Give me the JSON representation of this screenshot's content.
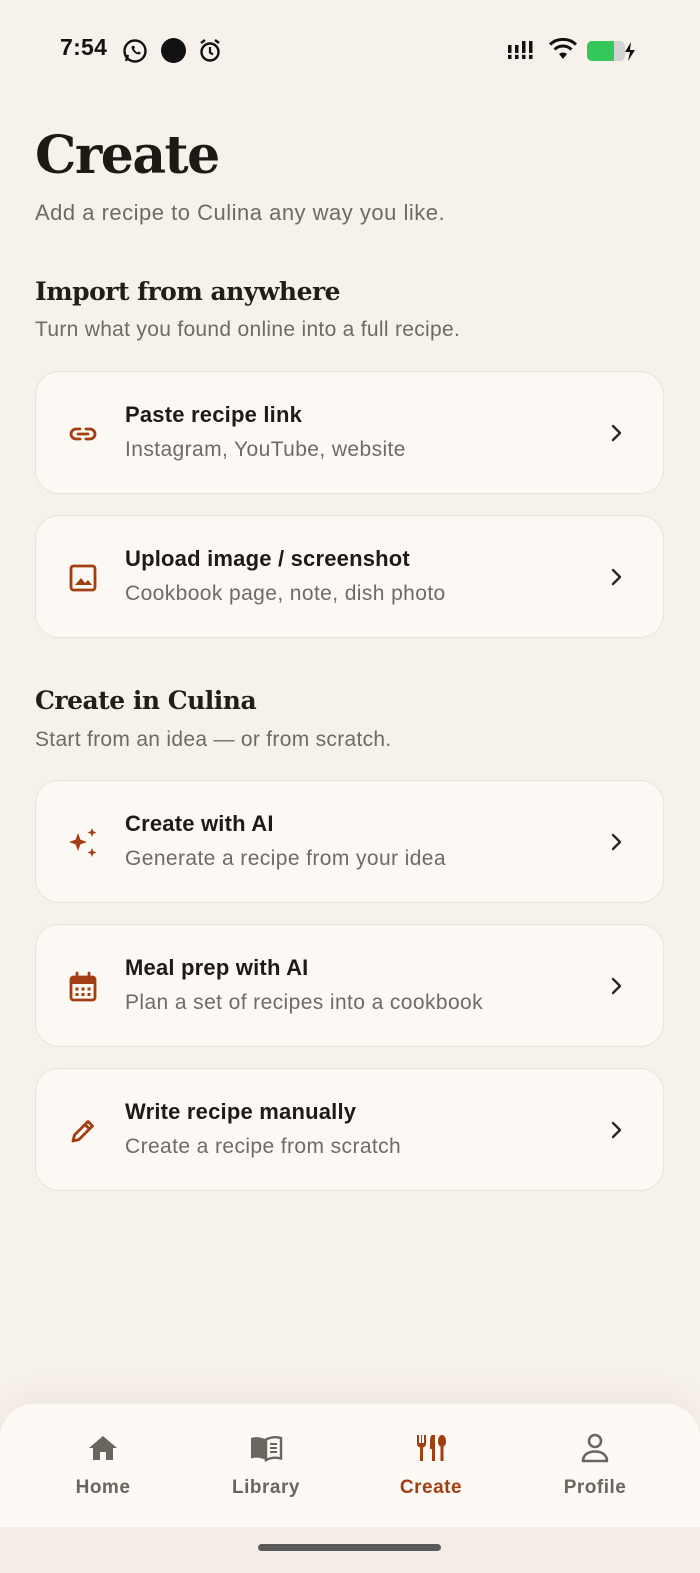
{
  "status_bar": {
    "time": "7:54"
  },
  "header": {
    "title": "Create",
    "subtitle": "Add a recipe to Culina any way you like."
  },
  "sections": [
    {
      "title": "Import from anywhere",
      "subtitle": "Turn what you found online into a full recipe.",
      "items": [
        {
          "icon": "link-icon",
          "title": "Paste recipe link",
          "description": "Instagram, YouTube, website"
        },
        {
          "icon": "image-icon",
          "title": "Upload image / screenshot",
          "description": "Cookbook page, note, dish photo"
        }
      ]
    },
    {
      "title": "Create in Culina",
      "subtitle": "Start from an idea — or from scratch.",
      "items": [
        {
          "icon": "sparkles-icon",
          "title": "Create with AI",
          "description": "Generate a recipe from your idea"
        },
        {
          "icon": "calendar-icon",
          "title": "Meal prep with AI",
          "description": "Plan a set of recipes into a cookbook"
        },
        {
          "icon": "pencil-icon",
          "title": "Write recipe manually",
          "description": "Create a recipe from scratch"
        }
      ]
    }
  ],
  "bottom_nav": {
    "items": [
      {
        "label": "Home",
        "icon": "home-icon"
      },
      {
        "label": "Library",
        "icon": "book-icon"
      },
      {
        "label": "Create",
        "icon": "utensils-icon",
        "active": true
      },
      {
        "label": "Profile",
        "icon": "user-icon"
      }
    ]
  },
  "colors": {
    "background": "#f7f1eb",
    "card": "#fcf8f3",
    "accent": "#a23f12",
    "text_primary": "#1f1a17",
    "text_secondary": "#6e6a66",
    "battery": "#34c759"
  }
}
